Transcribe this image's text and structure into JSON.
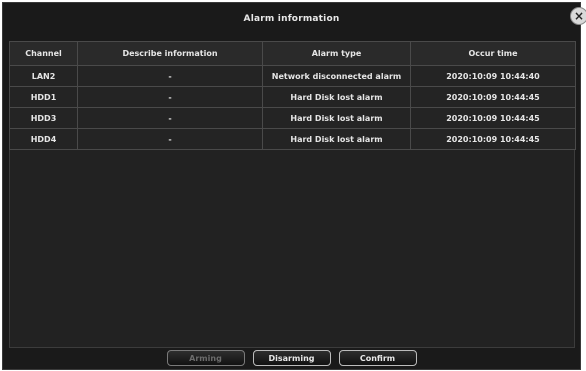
{
  "window": {
    "title": "Alarm information",
    "close_glyph": "×"
  },
  "table": {
    "headers": {
      "channel": "Channel",
      "describe": "Describe information",
      "alarm_type": "Alarm type",
      "occur_time": "Occur time"
    },
    "rows": [
      {
        "channel": "LAN2",
        "describe": "-",
        "alarm_type": "Network disconnected alarm",
        "occur_time": "2020:10:09 10:44:40"
      },
      {
        "channel": "HDD1",
        "describe": "-",
        "alarm_type": "Hard Disk lost alarm",
        "occur_time": "2020:10:09 10:44:45"
      },
      {
        "channel": "HDD3",
        "describe": "-",
        "alarm_type": "Hard Disk lost alarm",
        "occur_time": "2020:10:09 10:44:45"
      },
      {
        "channel": "HDD4",
        "describe": "-",
        "alarm_type": "Hard Disk lost alarm",
        "occur_time": "2020:10:09 10:44:45"
      }
    ]
  },
  "buttons": {
    "arming": "Arming",
    "disarming": "Disarming",
    "confirm": "Confirm"
  },
  "colors": {
    "background": "#1a1a1a",
    "text": "#e6e6e6",
    "grid": "#4a4a4a",
    "disabled_text": "#6c6c6c"
  }
}
